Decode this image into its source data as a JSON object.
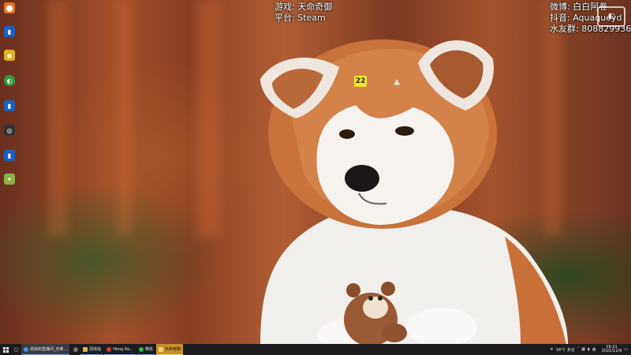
{
  "overlay": {
    "game_label": "游戏:",
    "game_value": "天命奇御",
    "platform_label": "平台:",
    "platform_value": "Steam",
    "weibo_label": "微博:",
    "weibo_value": "白白阿卷",
    "douyin_label": "抖音:",
    "douyin_value": "Aquaqueyd",
    "fans_label": "水友群:",
    "fans_value": "808829936",
    "badge_number": "22"
  },
  "taskbar": {
    "tasks": [
      {
        "label": "自由的直播间_天命...",
        "icon_color": "#4a90e2"
      },
      {
        "label": "回收站",
        "icon_color": "#e2b84a"
      },
      {
        "label": "Hong Ko...",
        "icon_color": "#d23c3c"
      },
      {
        "label": "微信",
        "icon_color": "#32b34a"
      },
      {
        "label": "天命奇御",
        "icon_color": "#f5d36b"
      }
    ],
    "weather": "16°C 多云",
    "language": "英",
    "time": "19:21",
    "date": "2021/11/9"
  },
  "colors": {
    "taskbar_bg": "#1c1c1f",
    "badge_yellow": "#f3e52a",
    "active_task": "#c6902a"
  }
}
